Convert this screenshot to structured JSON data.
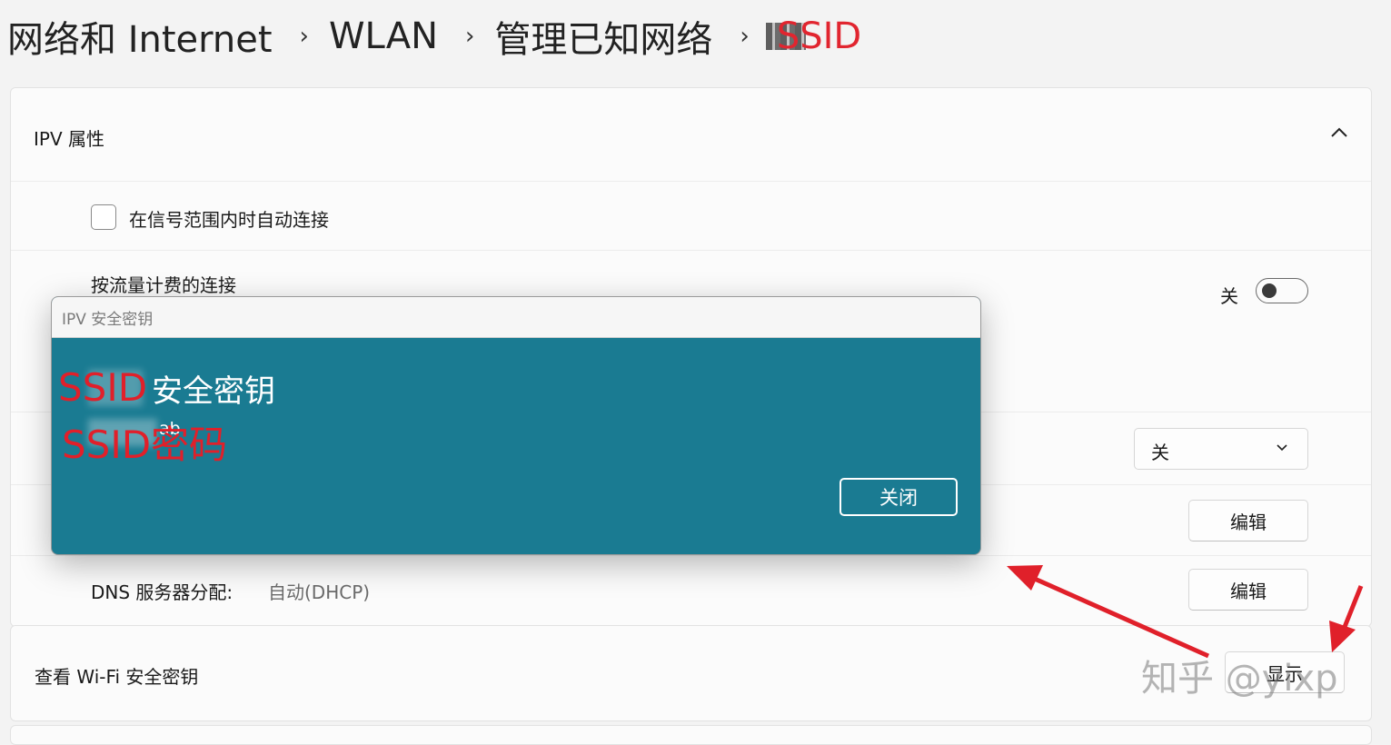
{
  "breadcrumb": {
    "items": [
      "网络和 Internet",
      "WLAN",
      "管理已知网络"
    ],
    "current": "SSID",
    "separator": "›"
  },
  "properties_card": {
    "title": "IPV 属性",
    "auto_connect_label": "在信号范围内时自动连接",
    "metered_label": "按流量计费的连接",
    "metered_toggle_label": "关",
    "select_value": "关",
    "edit_label_1": "编辑",
    "dns_label": "DNS 服务器分配:",
    "dns_value": "自动(DHCP)",
    "edit_label_2": "编辑"
  },
  "wifi_key_row": {
    "label": "查看 Wi-Fi 安全密钥",
    "show_button": "显示"
  },
  "dialog": {
    "window_title": "IPV 安全密钥",
    "heading": "安全密钥",
    "password_masked": "ab",
    "close_button": "关闭"
  },
  "annotations": {
    "ssid_note": "SSID",
    "password_note": "SSID密码",
    "color": "#e0202a"
  },
  "watermark": "知乎 @yixp",
  "colors": {
    "dialog_bg": "#1a7b92",
    "accent_red": "#e0202a"
  }
}
